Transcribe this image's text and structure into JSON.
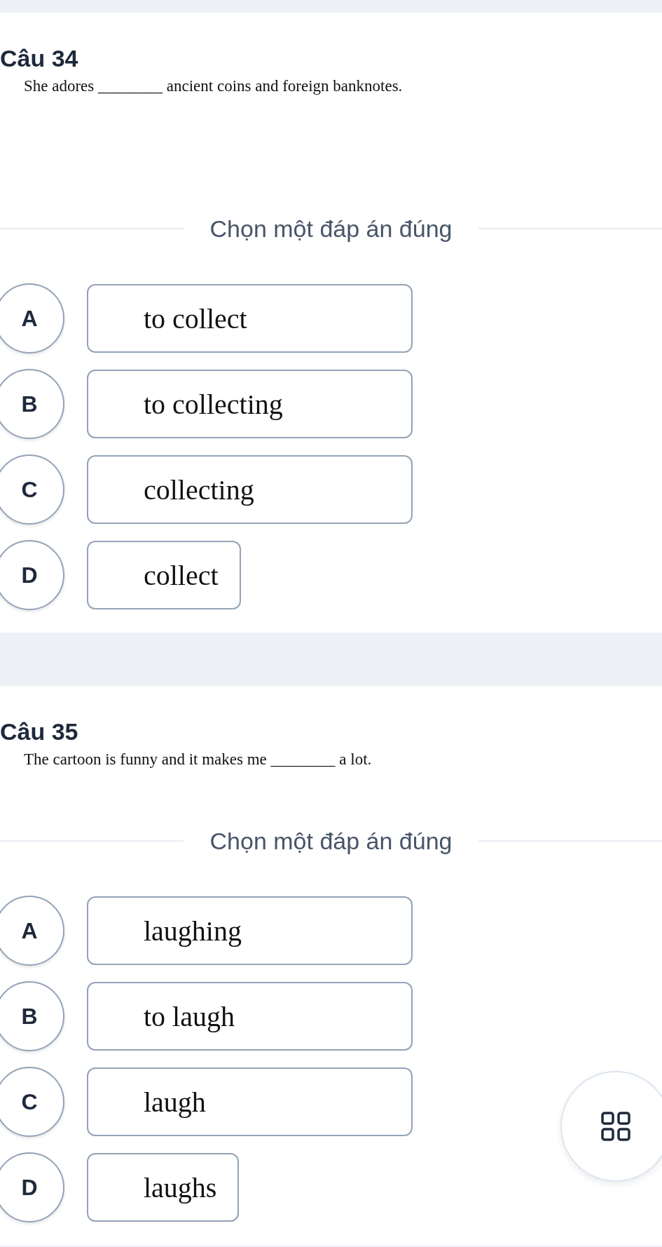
{
  "questions": [
    {
      "number": "Câu 34",
      "prompt": "She adores ________ ancient coins and foreign banknotes.",
      "instruction": "Chọn một đáp án đúng",
      "options": [
        {
          "letter": "A",
          "text": "to collect",
          "selected": false
        },
        {
          "letter": "B",
          "text": "to collecting",
          "selected": false
        },
        {
          "letter": "C",
          "text": "collecting",
          "selected": false
        },
        {
          "letter": "D",
          "text": "collect",
          "selected": false
        }
      ]
    },
    {
      "number": "Câu 35",
      "prompt": "The cartoon is funny and it makes me ________ a lot.",
      "instruction": "Chọn một đáp án đúng",
      "options": [
        {
          "letter": "A",
          "text": "laughing",
          "selected": false
        },
        {
          "letter": "B",
          "text": "to laugh",
          "selected": false
        },
        {
          "letter": "C",
          "text": "laugh",
          "selected": false
        },
        {
          "letter": "D",
          "text": "laughs",
          "selected": false
        }
      ]
    }
  ]
}
